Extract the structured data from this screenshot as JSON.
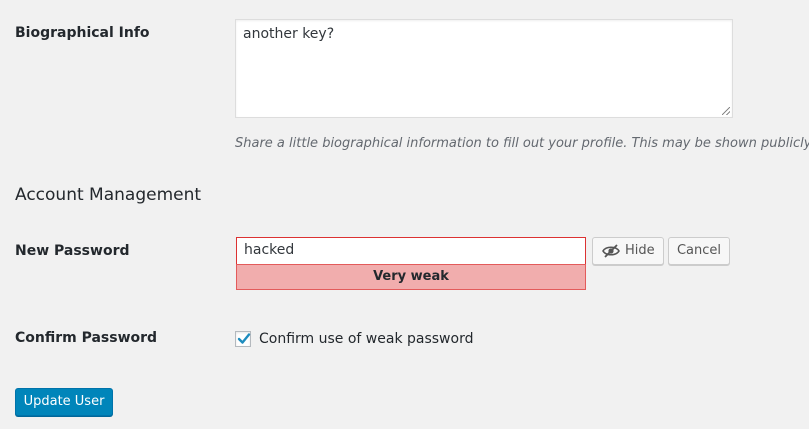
{
  "bio": {
    "label": "Biographical Info",
    "value": "another key?",
    "description": "Share a little biographical information to fill out your profile. This may be shown publicly."
  },
  "account": {
    "title": "Account Management",
    "new_password_label": "New Password",
    "password_value": "hacked",
    "strength_text": "Very weak",
    "hide_label": "Hide",
    "hide_icon": "eye-slash-icon",
    "cancel_label": "Cancel",
    "confirm_label": "Confirm Password",
    "confirm_checkbox_label": "Confirm use of weak password",
    "confirm_checked": true
  },
  "actions": {
    "update_label": "Update User"
  },
  "colors": {
    "background": "#f1f1f1",
    "primary": "#0085ba",
    "weak_bg": "#f1adad",
    "weak_border": "#e35b5b",
    "check": "#1e8cbe"
  }
}
